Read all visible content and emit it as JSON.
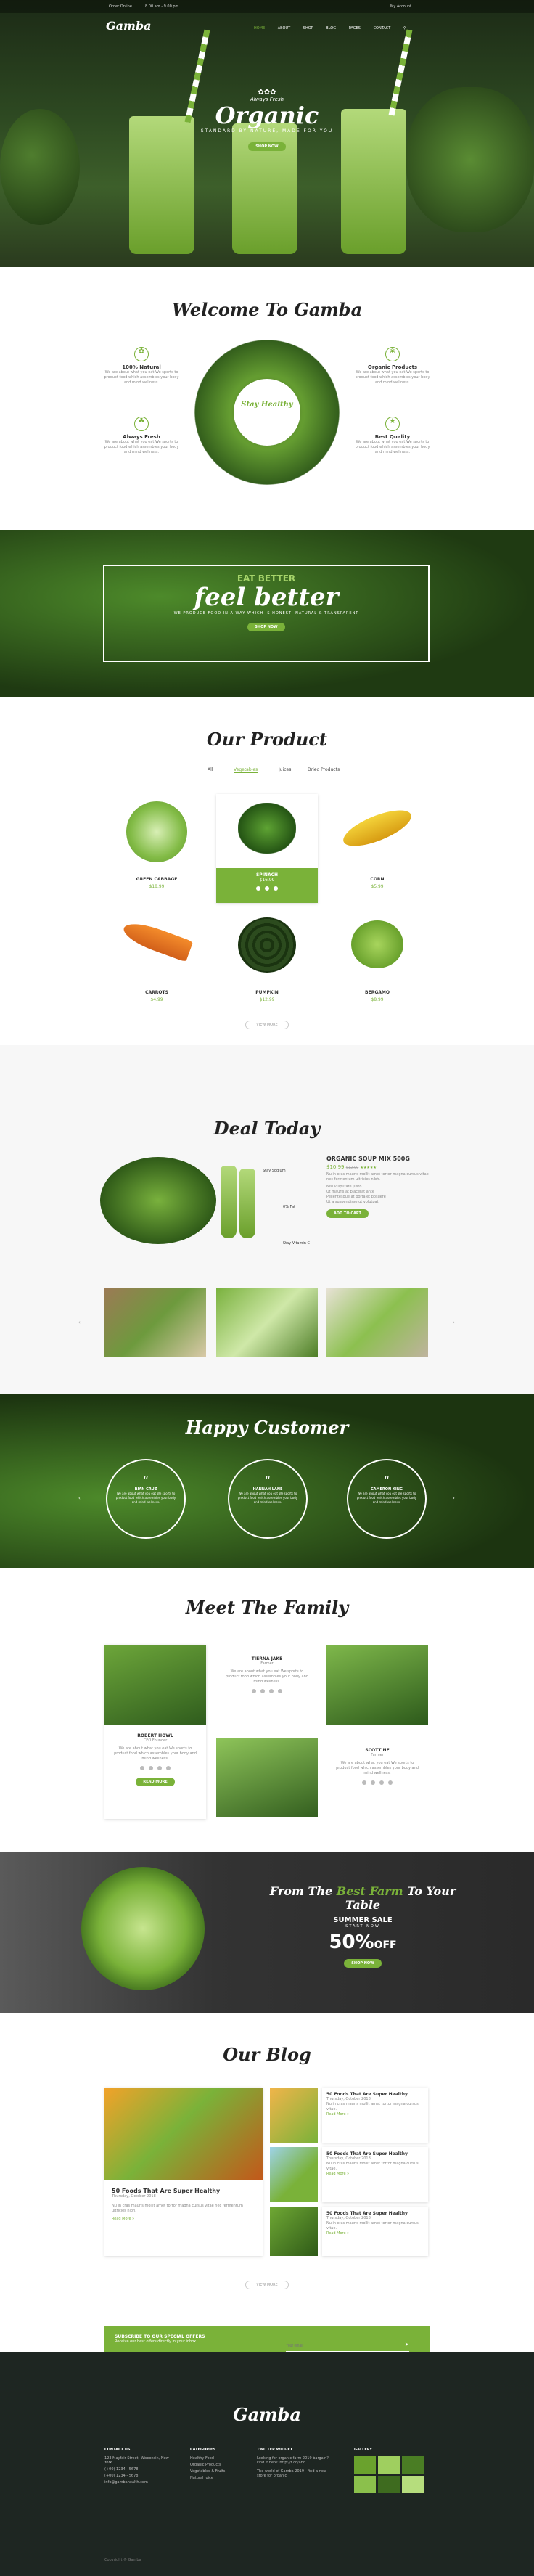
{
  "topbar": {
    "phone": "Order Online",
    "hours": "8.00 am - 9.00 pm",
    "account": "My Account"
  },
  "nav": {
    "logo": "Gamba",
    "items": [
      "HOME",
      "ABOUT",
      "SHOP",
      "BLOG",
      "PAGES",
      "CONTACT"
    ]
  },
  "hero": {
    "small": "Always Fresh",
    "title": "Organic",
    "tagline": "STANDARD BY NATURE, MADE FOR YOU",
    "button": "SHOP NOW"
  },
  "welcome": {
    "title": "Welcome To Gamba",
    "center_badge": "Stay Healthy",
    "features": [
      {
        "title": "100% Natural",
        "text": "We are about what you eat We sports to product food which assembles your body and mind wellness."
      },
      {
        "title": "Organic Products",
        "text": "We are about what you eat We sports to product food which assembles your body and mind wellness."
      },
      {
        "title": "Always Fresh",
        "text": "We are about what you eat We sports to product food which assembles your body and mind wellness."
      },
      {
        "title": "Best Quality",
        "text": "We are about what you eat We sports to product food which assembles your body and mind wellness."
      }
    ]
  },
  "banner": {
    "small": "EAT BETTER",
    "big": "feel better",
    "sub": "WE PRODUCE FOOD IN A WAY WHICH IS HONEST, NATURAL & TRANSPARENT",
    "button": "SHOP NOW"
  },
  "products": {
    "title": "Our Product",
    "tabs": [
      "All",
      "Vegetables",
      "Juices",
      "Dried Products"
    ],
    "items": [
      {
        "name": "GREEN CABBAGE",
        "price": "$18.99"
      },
      {
        "name": "SPINACH",
        "price": "$16.99"
      },
      {
        "name": "CORN",
        "price": "$5.99"
      },
      {
        "name": "CARROTS",
        "price": "$4.99"
      },
      {
        "name": "PUMPKIN",
        "price": "$12.99"
      },
      {
        "name": "BERGAMO",
        "price": "$8.99"
      }
    ],
    "more": "VIEW MORE"
  },
  "deal": {
    "title": "Deal Today",
    "product": "ORGANIC SOUP MIX 500G",
    "price": "$10.99",
    "old": "$12.99",
    "desc": "Nu in cras mauris mollit amet tortor magna cursus vitae nec fermentum ultricies nibh. ",
    "bullets": [
      "Nisl vulputate justo",
      "Ut mauris at placerat ante",
      "Pellentesque at porta et posuere",
      "Ut a suspendisse ut volutpat"
    ],
    "button": "ADD TO CART",
    "labels": [
      "Stay Sodium",
      "0% Fat",
      "Stay Vitamin C"
    ]
  },
  "testimonials": {
    "title": "Happy Customer",
    "items": [
      {
        "name": "RIAN CRUZ",
        "text": "We are about what you eat We sports to product food which assembles your body and mind wellness."
      },
      {
        "name": "HANNAH LANE",
        "text": "We are about what you eat We sports to product food which assembles your body and mind wellness."
      },
      {
        "name": "CAMERON KING",
        "text": "We are about what you eat We sports to product food which assembles your body and mind wellness."
      }
    ]
  },
  "family": {
    "title": "Meet The Family",
    "members": [
      {
        "name": "ROBERT HOWL",
        "role": "CEO Founder",
        "text": "We are about what you eat We sports to product food which assembles your body and mind wellness."
      },
      {
        "name": "TIERNA JAKE",
        "role": "Farmer",
        "text": "We are about what you eat We sports to product food which assembles your body and mind wellness."
      },
      {
        "name": "SCOTT NE",
        "role": "Farmer",
        "text": "We are about what you eat We sports to product food which assembles your body and mind wellness."
      }
    ],
    "button": "READ MORE"
  },
  "sale": {
    "line1": "From The ",
    "line1b": "Best Farm",
    "line1c": " To Your Table",
    "label": "SUMMER SALE",
    "sub": "START NOW",
    "percent": "50%",
    "off": "OFF",
    "button": "SHOP NOW"
  },
  "blog": {
    "title": "Our Blog",
    "main": {
      "title": "50 Foods That Are Super Healthy",
      "meta": "Thursday, October 2018",
      "text": "Nu in cras mauris mollit amet tortor magna cursus vitae nec fermentum ultricies nibh.",
      "more": "Read More »"
    },
    "side": [
      {
        "title": "50 Foods That Are Super Healthy",
        "meta": "Thursday, October 2018",
        "text": "Nu in cras mauris mollit amet tortor magna cursus vitae.",
        "more": "Read More »"
      },
      {
        "title": "50 Foods That Are Super Healthy",
        "meta": "Thursday, October 2018",
        "text": "Nu in cras mauris mollit amet tortor magna cursus vitae.",
        "more": "Read More »"
      },
      {
        "title": "50 Foods That Are Super Healthy",
        "meta": "Thursday, October 2018",
        "text": "Nu in cras mauris mollit amet tortor magna cursus vitae.",
        "more": "Read More »"
      }
    ],
    "more": "VIEW MORE"
  },
  "newsletter": {
    "title": "SUBSCRIBE TO OUR SPECIAL OFFERS",
    "text": "Receive our best offers directly in your inbox",
    "placeholder": "Your email"
  },
  "footer": {
    "logo": "Gamba",
    "contact_title": "CONTACT US",
    "contact": [
      "123 Mayfair Street, Wisconsin, New York",
      "(+00) 1234 - 5678",
      "(+00) 1234 - 5678",
      "info@gambahealth.com"
    ],
    "cat_title": "CATEGORIES",
    "cats": [
      "Healthy Food",
      "Organic Products",
      "Vegetables & Fruits",
      "Natural Juice"
    ],
    "tw_title": "TWITTER WIDGET",
    "tweets": [
      "Looking for organic farm 2019 bargain? Find it here: http://t.co/abc",
      "The world of Gamba 2019 - find a new store for organic"
    ],
    "gal_title": "GALLERY",
    "copyright": "Copyright © Gamba"
  }
}
